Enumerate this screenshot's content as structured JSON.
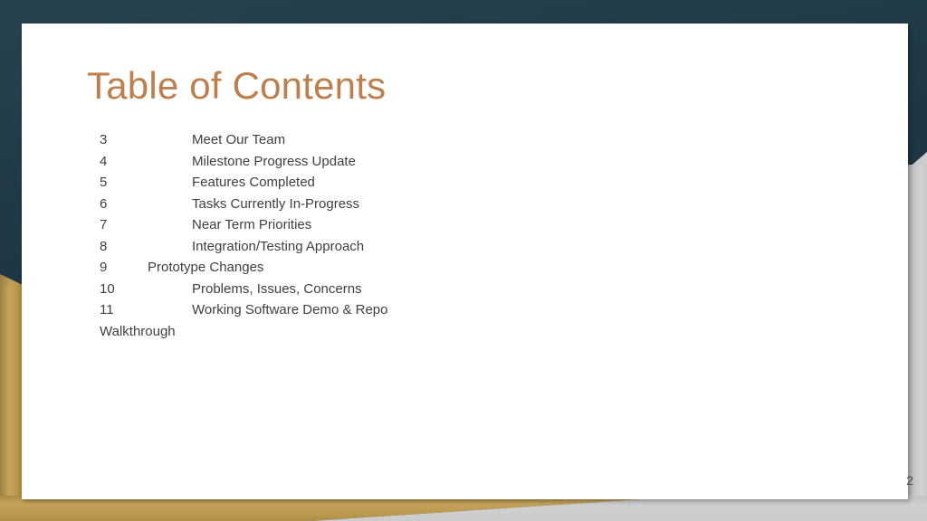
{
  "slide": {
    "title": "Table of Contents",
    "page_number": "2",
    "colors": {
      "frame_teal": "#20394A",
      "accent_gold": "#C4A259",
      "title_copper": "#BE7F4E",
      "body_text": "#3F3F3F",
      "card_white": "#FFFFFF",
      "shadow_gray": "#C6C6C6"
    }
  },
  "toc": {
    "items": [
      {
        "number": "3",
        "label": "Meet Our Team",
        "short_tab": false
      },
      {
        "number": "4",
        "label": "Milestone Progress Update",
        "short_tab": false
      },
      {
        "number": "5",
        "label": "Features Completed",
        "short_tab": false
      },
      {
        "number": "6",
        "label": "Tasks Currently In-Progress",
        "short_tab": false
      },
      {
        "number": "7",
        "label": "Near Term Priorities",
        "short_tab": false
      },
      {
        "number": "8",
        "label": "Integration/Testing Approach",
        "short_tab": false
      },
      {
        "number": "9",
        "label": "Prototype Changes",
        "short_tab": true
      },
      {
        "number": "10",
        "label": "Problems, Issues, Concerns",
        "short_tab": false
      },
      {
        "number": "11",
        "label": "Working Software Demo & Repo",
        "short_tab": false
      }
    ],
    "wrapped_line": "Walkthrough"
  }
}
